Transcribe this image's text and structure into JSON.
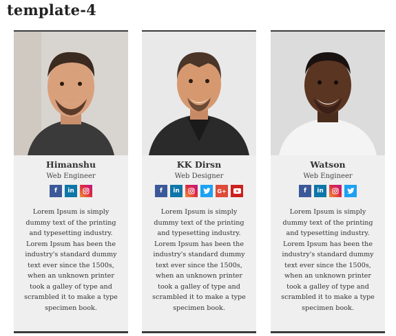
{
  "page_title": "template-4",
  "members": [
    {
      "name": "Himanshu",
      "role": "Web Engineer",
      "socials": [
        "facebook",
        "linkedin",
        "instagram"
      ],
      "description": "Lorem Ipsum is simply dummy text of the printing and typesetting industry. Lorem Ipsum has been the industry's standard dummy text ever since the 1500s, when an unknown printer took a galley of type and scrambled it to make a type specimen book."
    },
    {
      "name": "KK Dirsn",
      "role": "Web Designer",
      "socials": [
        "facebook",
        "linkedin",
        "instagram",
        "twitter",
        "google-plus",
        "youtube"
      ],
      "description": "Lorem Ipsum is simply dummy text of the printing and typesetting industry. Lorem Ipsum has been the industry's standard dummy text ever since the 1500s, when an unknown printer took a galley of type and scrambled it to make a type specimen book."
    },
    {
      "name": "Watson",
      "role": "Web Engineer",
      "socials": [
        "facebook",
        "linkedin",
        "instagram",
        "twitter"
      ],
      "description": "Lorem Ipsum is simply dummy text of the printing and typesetting industry. Lorem Ipsum has been the industry's standard dummy text ever since the 1500s, when an unknown printer took a galley of type and scrambled it to make a type specimen book."
    }
  ],
  "colors": {
    "card_background": "#efefef",
    "card_border": "#3a3a3a",
    "facebook": "#3b5998",
    "linkedin": "#0e76a8",
    "twitter": "#1da1f2",
    "google_plus": "#dd4b39",
    "youtube": "#cd201f"
  }
}
